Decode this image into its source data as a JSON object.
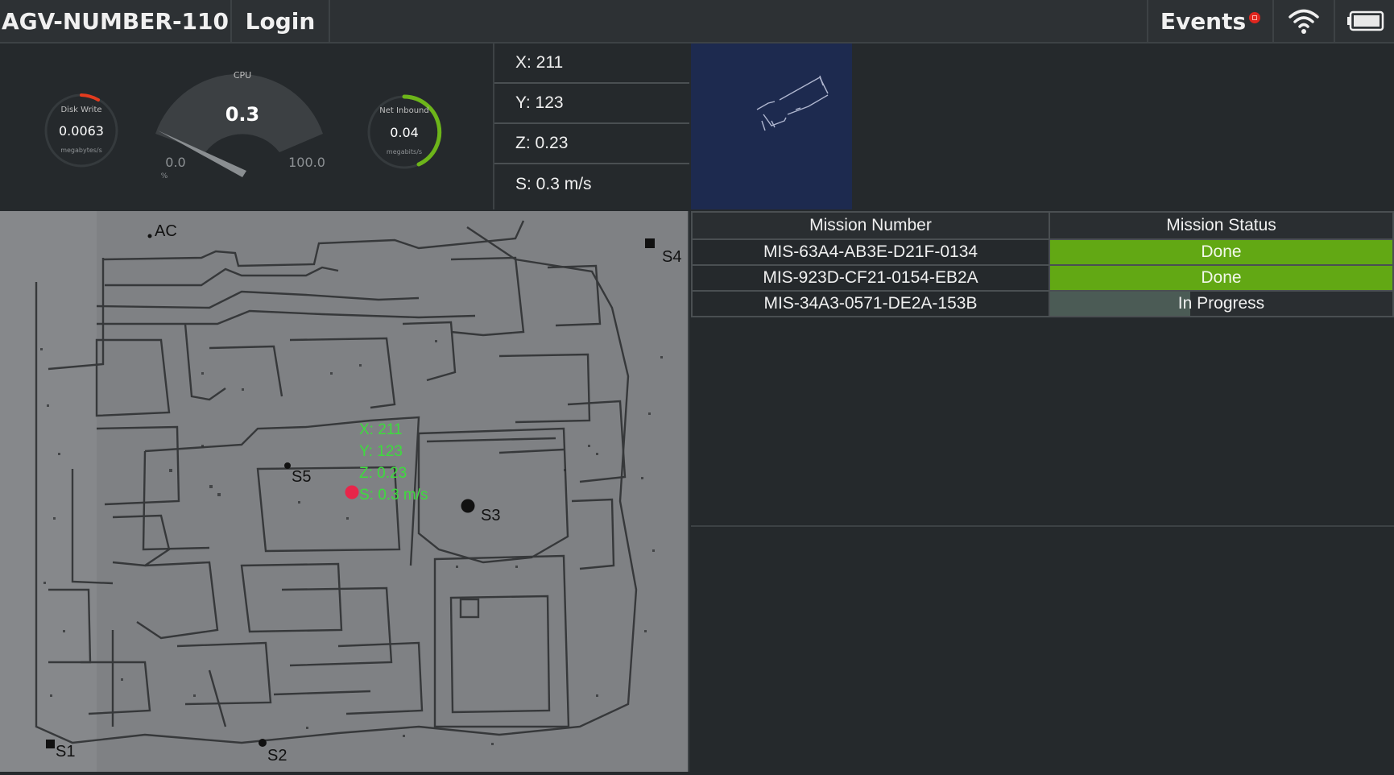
{
  "topbar": {
    "title": "AGV-NUMBER-110",
    "login_label": "Login",
    "events_label": "Events"
  },
  "gauges": {
    "disk_write": {
      "label": "Disk Write",
      "value": "0.0063",
      "unit": "megabytes/s"
    },
    "cpu": {
      "label": "CPU",
      "value": "0.3",
      "min": "0.0",
      "max": "100.0",
      "unit": "%"
    },
    "net_inbound": {
      "label": "Net Inbound",
      "value": "0.04",
      "unit": "megabits/s"
    }
  },
  "coords": {
    "x": "X: 211",
    "y": "Y: 123",
    "z": "Z: 0.23",
    "s": "S: 0.3 m/s"
  },
  "map": {
    "stations": {
      "ac": "AC",
      "s1": "S1",
      "s2": "S2",
      "s3": "S3",
      "s4": "S4",
      "s5": "S5"
    },
    "robot": {
      "x": "X: 211",
      "y": "Y: 123",
      "z": "Z: 0.23",
      "s": "S: 0.3 m/s"
    }
  },
  "missions": {
    "headers": {
      "number": "Mission Number",
      "status": "Mission Status"
    },
    "rows": [
      {
        "number": "MIS-63A4-AB3E-D21F-0134",
        "status": "Done"
      },
      {
        "number": "MIS-923D-CF21-0154-EB2A",
        "status": "Done"
      },
      {
        "number": "MIS-34A3-0571-DE2A-153B",
        "status": "In Progress",
        "progress": 0.41
      }
    ]
  },
  "colors": {
    "done": "#62a814",
    "robot": "#e8254a",
    "robot_text": "#3ddc3d"
  }
}
